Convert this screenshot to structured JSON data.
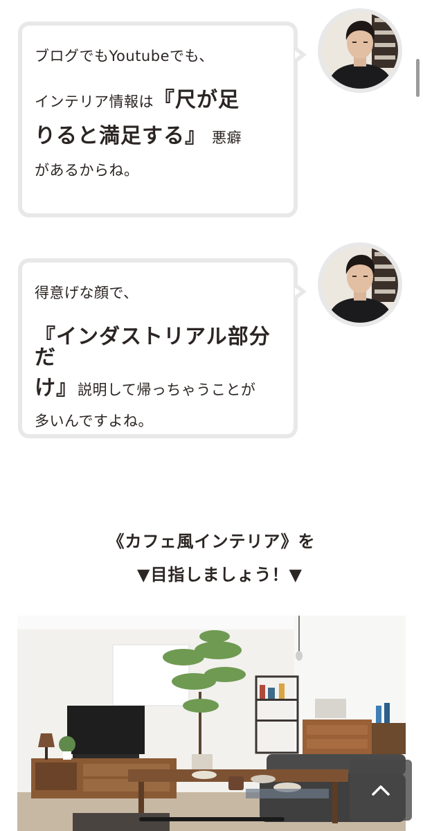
{
  "bubble1": {
    "line1": "ブログでもYoutubeでも、",
    "line2_prefix": "インテリア情報は",
    "line2_strong": "『尺が足",
    "line3_strong": "りると満足する』",
    "line3_suffix": "悪癖",
    "line4": "があるからね。"
  },
  "bubble2": {
    "line1": "得意げな顔で、",
    "line2_strong": "『インダストリアル部分だ",
    "line3_strong": "け』",
    "line3_suffix": "説明して帰っちゃうことが",
    "line4": "多いんですよね。"
  },
  "cta": {
    "line1": "《カフェ風インテリア》を",
    "line2": "▼目指しましょう！▼"
  },
  "colors": {
    "text": "#2b2523",
    "bubble_border": "#e8e8e8",
    "page_bg": "#ffffff"
  },
  "icons": {
    "back_to_top": "chevron-up-icon"
  }
}
